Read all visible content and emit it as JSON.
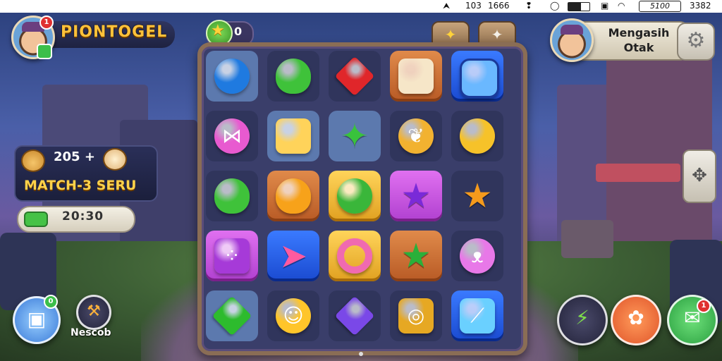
{
  "status_bar": {
    "time_a": "103",
    "time_b": "1666",
    "box_label": "5100",
    "clock": "3382"
  },
  "player": {
    "name": "PIONTOGEL",
    "notification_count": "1"
  },
  "stars": {
    "count": "0"
  },
  "score_panel": {
    "score": "205 +",
    "mode": "MATCH-3 SERU"
  },
  "timer": {
    "value": "20:30"
  },
  "opponent": {
    "name_line1": "Mengasih",
    "name_line2": "Otak"
  },
  "bottom_nav": {
    "left_label": "Nescob",
    "left_badge": "0",
    "right_badge": "1"
  },
  "board": {
    "rows": [
      [
        "blue-gem",
        "green-heart",
        "red-gem",
        "orange-card",
        "royal-hex"
      ],
      [
        "pink-bow",
        "yellow-square",
        "green-diamond",
        "leaf-cookie",
        "gold-lemon"
      ],
      [
        "green-heart",
        "orange-heart",
        "green-orb",
        "purple-star",
        "orange-star"
      ],
      [
        "purple-dots",
        "blue-arrow",
        "pink-ring",
        "green-star",
        "pink-cat"
      ],
      [
        "green-rhombus",
        "yellow-smiley",
        "purple-crystal",
        "gold-chest",
        "ice-shard"
      ]
    ]
  },
  "colors": {
    "accent_gold": "#ffc23a",
    "board_frame": "#8a6d55",
    "board_bg": "#3a3e6a"
  }
}
